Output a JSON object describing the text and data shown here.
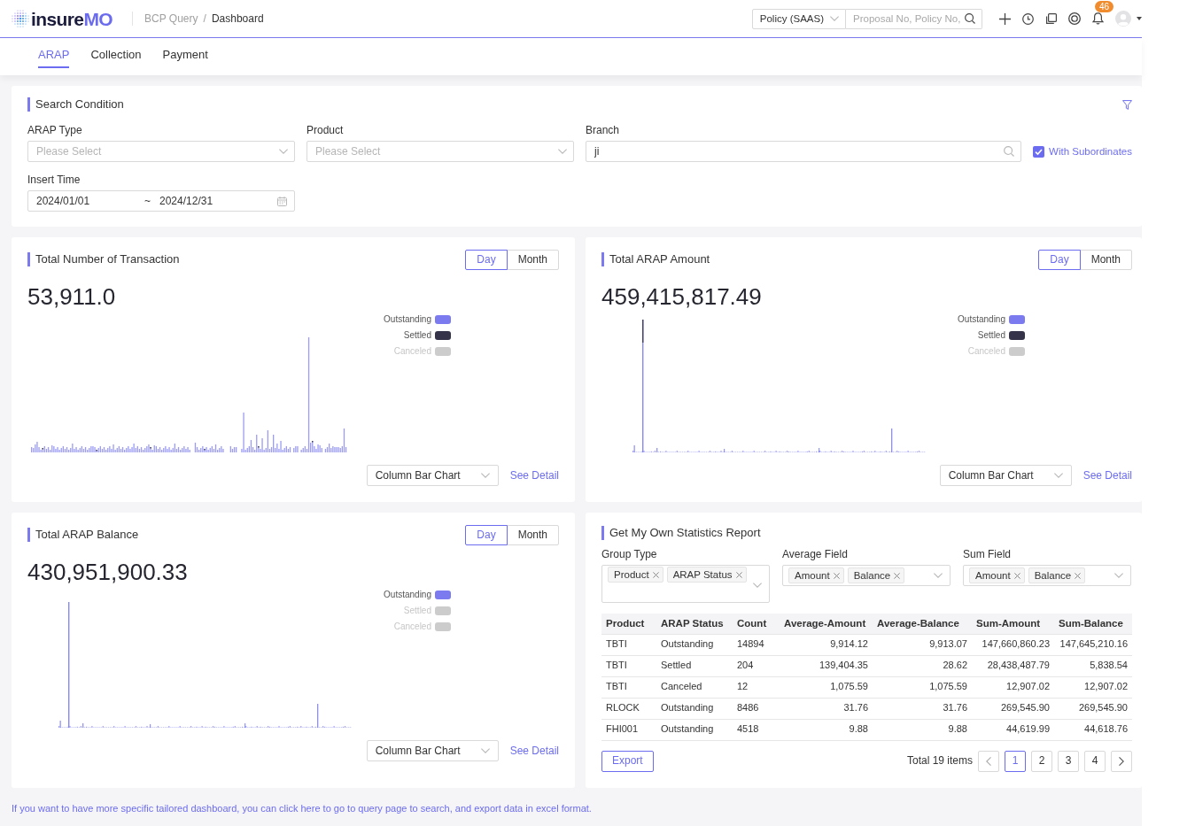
{
  "header": {
    "logo": [
      "insure",
      "MO"
    ],
    "breadcrumb": [
      {
        "label": "BCP Query",
        "current": false
      },
      {
        "label": "Dashboard",
        "current": true
      }
    ],
    "breadcrumb_separator": "/",
    "scope_select": "Policy (SAAS)",
    "search": {
      "placeholder": "Proposal No, Policy No,"
    },
    "notification_count": "46"
  },
  "tabs": [
    {
      "label": "ARAP",
      "selected": true
    },
    {
      "label": "Collection",
      "selected": false
    },
    {
      "label": "Payment",
      "selected": false
    }
  ],
  "search_condition": {
    "title": "Search Condition",
    "fields": [
      {
        "kind": "select",
        "label": "ARAP Type",
        "placeholder": "Please Select"
      },
      {
        "kind": "select",
        "label": "Product",
        "placeholder": "Please Select"
      },
      {
        "kind": "search",
        "label": "Branch",
        "value": "ji"
      },
      {
        "kind": "date_range",
        "label": "Insert Time",
        "start": "2024/01/01",
        "separator": "~",
        "end": "2024/12/31"
      }
    ],
    "with_subordinates": {
      "label": "With Subordinates",
      "checked": true
    }
  },
  "chart_cards": [
    {
      "title": "Total Number of Transaction",
      "periods": [
        {
          "label": "Day",
          "selected": true
        },
        {
          "label": "Month",
          "selected": false
        }
      ],
      "total": "53,911.0",
      "legend": [
        {
          "label": "Outstanding",
          "color": "#7b7bef",
          "on": true
        },
        {
          "label": "Settled",
          "color": "#35334a",
          "on": true
        },
        {
          "label": "Canceled",
          "on": false
        }
      ],
      "chart_type": "Column Bar Chart",
      "detail_link": "See Detail"
    },
    {
      "title": "Total ARAP Amount",
      "periods": [
        {
          "label": "Day",
          "selected": true
        },
        {
          "label": "Month",
          "selected": false
        }
      ],
      "total": "459,415,817.49",
      "legend": [
        {
          "label": "Outstanding",
          "color": "#7b7bef",
          "on": true
        },
        {
          "label": "Settled",
          "color": "#35334a",
          "on": true
        },
        {
          "label": "Canceled",
          "on": false
        }
      ],
      "chart_type": "Column Bar Chart",
      "detail_link": "See Detail"
    },
    {
      "title": "Total ARAP Balance",
      "periods": [
        {
          "label": "Day",
          "selected": true
        },
        {
          "label": "Month",
          "selected": false
        }
      ],
      "total": "430,951,900.33",
      "legend": [
        {
          "label": "Outstanding",
          "color": "#7b7bef",
          "on": true
        },
        {
          "label": "Settled",
          "on": false
        },
        {
          "label": "Canceled",
          "on": false
        }
      ],
      "chart_type": "Column Bar Chart",
      "detail_link": "See Detail"
    }
  ],
  "statistics": {
    "title": "Get My Own Statistics Report",
    "filters": [
      {
        "label": "Group Type",
        "tags": [
          "Product",
          "ARAP Status"
        ]
      },
      {
        "label": "Average Field",
        "tags": [
          "Amount",
          "Balance"
        ]
      },
      {
        "label": "Sum Field",
        "tags": [
          "Amount",
          "Balance"
        ]
      }
    ],
    "table": {
      "columns": [
        "Product",
        "ARAP Status",
        "Count",
        "Average-Amount",
        "Average-Balance",
        "Sum-Amount",
        "Sum-Balance"
      ],
      "rows": [
        [
          "TBTI",
          "Outstanding",
          "14894",
          "9,914.12",
          "9,913.07",
          "147,660,860.23",
          "147,645,210.16"
        ],
        [
          "TBTI",
          "Settled",
          "204",
          "139,404.35",
          "28.62",
          "28,438,487.79",
          "5,838.54"
        ],
        [
          "TBTI",
          "Canceled",
          "12",
          "1,075.59",
          "1,075.59",
          "12,907.02",
          "12,907.02"
        ],
        [
          "RLOCK",
          "Outstanding",
          "8486",
          "31.76",
          "31.76",
          "269,545.90",
          "269,545.90"
        ],
        [
          "FHI001",
          "Outstanding",
          "4518",
          "9.88",
          "9.88",
          "44,619.99",
          "44,618.76"
        ]
      ]
    },
    "export": "Export",
    "total": "Total 19 items",
    "pages": [
      {
        "label": "1",
        "selected": true
      },
      {
        "label": "2",
        "selected": false
      },
      {
        "label": "3",
        "selected": false
      },
      {
        "label": "4",
        "selected": false
      }
    ]
  },
  "footer_note": "If you want to have more specific tailored dashboard, you can click here to go to query page to search, and export data in excel format."
}
